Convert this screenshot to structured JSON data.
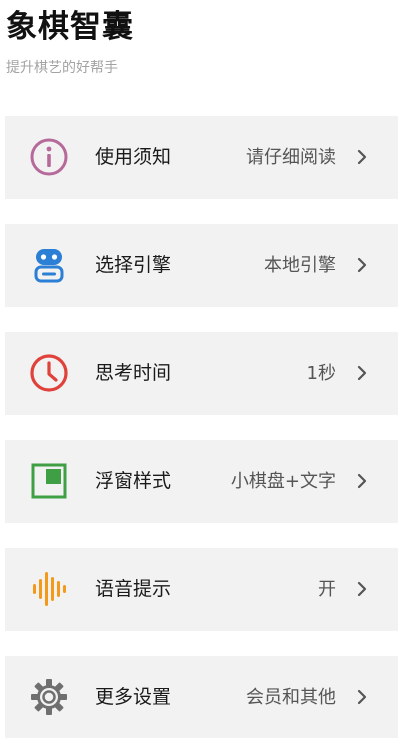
{
  "header": {
    "title": "象棋智囊",
    "subtitle": "提升棋艺的好帮手"
  },
  "menu": {
    "items": [
      {
        "icon": "info-icon",
        "label": "使用须知",
        "value": "请仔细阅读",
        "icon_color": "#b56a99"
      },
      {
        "icon": "robot-icon",
        "label": "选择引擎",
        "value": "本地引擎",
        "icon_color": "#2b7fd4"
      },
      {
        "icon": "clock-icon",
        "label": "思考时间",
        "value": "1秒",
        "icon_color": "#e0413a"
      },
      {
        "icon": "floating-window-icon",
        "label": "浮窗样式",
        "value": "小棋盘+文字",
        "icon_color": "#3f9f45"
      },
      {
        "icon": "sound-wave-icon",
        "label": "语音提示",
        "value": "开",
        "icon_color": "#f39a1a"
      },
      {
        "icon": "gear-icon",
        "label": "更多设置",
        "value": "会员和其他",
        "icon_color": "#6f6f6f"
      }
    ]
  },
  "colors": {
    "background": "#ffffff",
    "card": "#f2f2f2",
    "title": "#111111",
    "subtitle": "#a3a3a3",
    "value_text": "#555555",
    "chevron": "#555555"
  }
}
